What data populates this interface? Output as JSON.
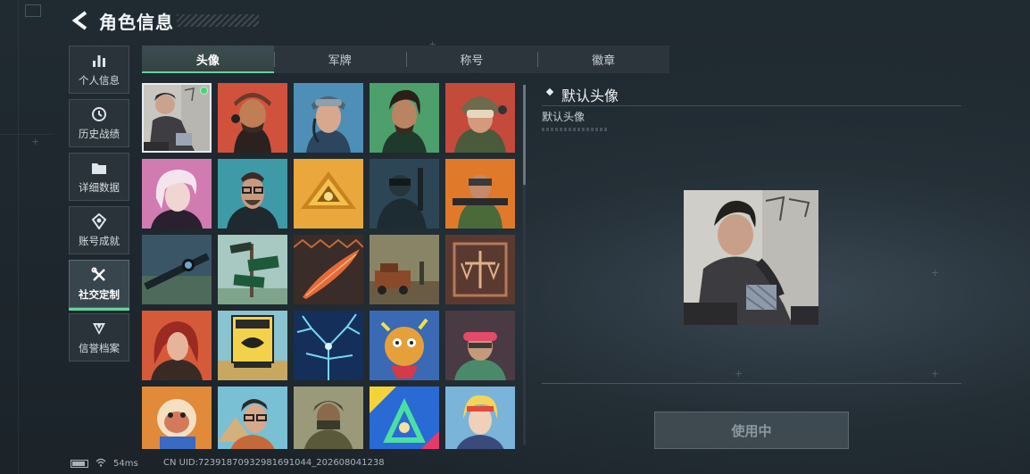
{
  "header": {
    "title": "角色信息"
  },
  "nav": [
    {
      "label": "个人信息",
      "icon": "bar-chart-icon"
    },
    {
      "label": "历史战绩",
      "icon": "history-icon"
    },
    {
      "label": "详细数据",
      "icon": "folder-icon"
    },
    {
      "label": "账号成就",
      "icon": "achievement-icon"
    },
    {
      "label": "社交定制",
      "icon": "wrench-icon",
      "active": true
    },
    {
      "label": "信誉档案",
      "icon": "shield-icon"
    }
  ],
  "tabs": [
    {
      "label": "头像",
      "active": true
    },
    {
      "label": "军牌"
    },
    {
      "label": "称号"
    },
    {
      "label": "徽章"
    }
  ],
  "avatar_grid": {
    "rows": 5,
    "cols": 5,
    "selected_index": 0,
    "scroll_fraction": 0.0
  },
  "detail": {
    "name": "默认头像",
    "description": "默认头像"
  },
  "use_button": {
    "label": "使用中"
  },
  "status": {
    "ping": "54ms",
    "uid": "CN UID:72391870932981691044_202608041238"
  },
  "colors": {
    "accent": "#5fd3a0",
    "selected_dot": "#4ed17b"
  }
}
